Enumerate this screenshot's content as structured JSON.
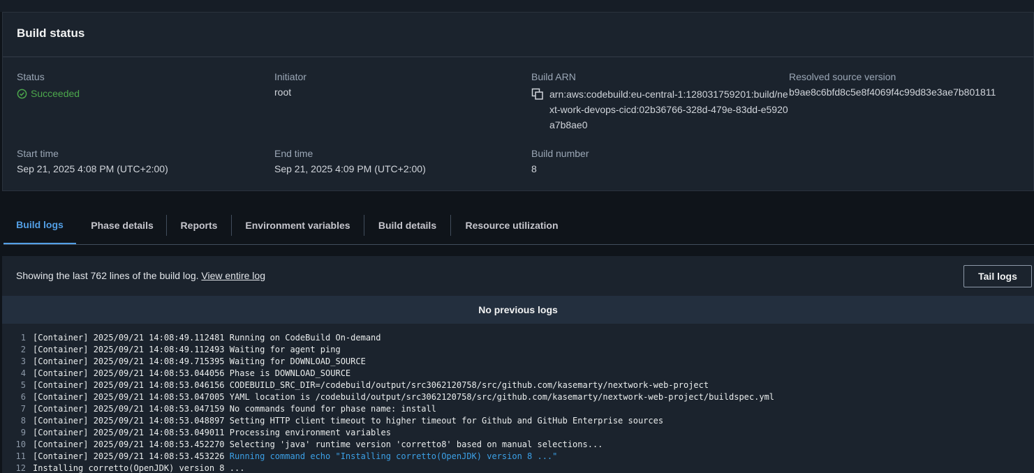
{
  "build_status": {
    "title": "Build status",
    "status_label": "Status",
    "status_value": "Succeeded",
    "initiator_label": "Initiator",
    "initiator_value": "root",
    "arn_label": "Build ARN",
    "arn_value": "arn:aws:codebuild:eu-central-1:128031759201:build/next-work-devops-cicd:02b36766-328d-479e-83dd-e5920a7b8ae0",
    "source_label": "Resolved source version",
    "source_value": "b9ae8c6bfd8c5e8f4069f4c99d83e3ae7b801811",
    "start_label": "Start time",
    "start_value": "Sep 21, 2025 4:08 PM (UTC+2:00)",
    "end_label": "End time",
    "end_value": "Sep 21, 2025 4:09 PM (UTC+2:00)",
    "number_label": "Build number",
    "number_value": "8",
    "status_color": "#4ca74c"
  },
  "tabs": [
    {
      "label": "Build logs",
      "active": true
    },
    {
      "label": "Phase details",
      "active": false
    },
    {
      "label": "Reports",
      "active": false
    },
    {
      "label": "Environment variables",
      "active": false
    },
    {
      "label": "Build details",
      "active": false
    },
    {
      "label": "Resource utilization",
      "active": false
    }
  ],
  "logs": {
    "info_text": "Showing the last 762 lines of the build log. ",
    "view_link": "View entire log",
    "tail_button": "Tail logs",
    "no_previous": "No previous logs",
    "lines": [
      {
        "n": "1",
        "prefix": "[Container] 2025/09/21 14:08:49.112481 ",
        "text": "Running on CodeBuild On-demand",
        "cmd": false
      },
      {
        "n": "2",
        "prefix": "[Container] 2025/09/21 14:08:49.112493 ",
        "text": "Waiting for agent ping",
        "cmd": false
      },
      {
        "n": "3",
        "prefix": "[Container] 2025/09/21 14:08:49.715395 ",
        "text": "Waiting for DOWNLOAD_SOURCE",
        "cmd": false
      },
      {
        "n": "4",
        "prefix": "[Container] 2025/09/21 14:08:53.044056 ",
        "text": "Phase is DOWNLOAD_SOURCE",
        "cmd": false
      },
      {
        "n": "5",
        "prefix": "[Container] 2025/09/21 14:08:53.046156 ",
        "text": "CODEBUILD_SRC_DIR=/codebuild/output/src3062120758/src/github.com/kasemarty/nextwork-web-project",
        "cmd": false
      },
      {
        "n": "6",
        "prefix": "[Container] 2025/09/21 14:08:53.047005 ",
        "text": "YAML location is /codebuild/output/src3062120758/src/github.com/kasemarty/nextwork-web-project/buildspec.yml",
        "cmd": false
      },
      {
        "n": "7",
        "prefix": "[Container] 2025/09/21 14:08:53.047159 ",
        "text": "No commands found for phase name: install",
        "cmd": false
      },
      {
        "n": "8",
        "prefix": "[Container] 2025/09/21 14:08:53.048897 ",
        "text": "Setting HTTP client timeout to higher timeout for Github and GitHub Enterprise sources",
        "cmd": false
      },
      {
        "n": "9",
        "prefix": "[Container] 2025/09/21 14:08:53.049011 ",
        "text": "Processing environment variables",
        "cmd": false
      },
      {
        "n": "10",
        "prefix": "[Container] 2025/09/21 14:08:53.452270 ",
        "text": "Selecting 'java' runtime version 'corretto8' based on manual selections...",
        "cmd": false
      },
      {
        "n": "11",
        "prefix": "[Container] 2025/09/21 14:08:53.453226 ",
        "text": "Running command echo \"Installing corretto(OpenJDK) version 8 ...\"",
        "cmd": true
      },
      {
        "n": "12",
        "prefix": "",
        "text": "Installing corretto(OpenJDK) version 8 ...",
        "cmd": false
      }
    ]
  }
}
